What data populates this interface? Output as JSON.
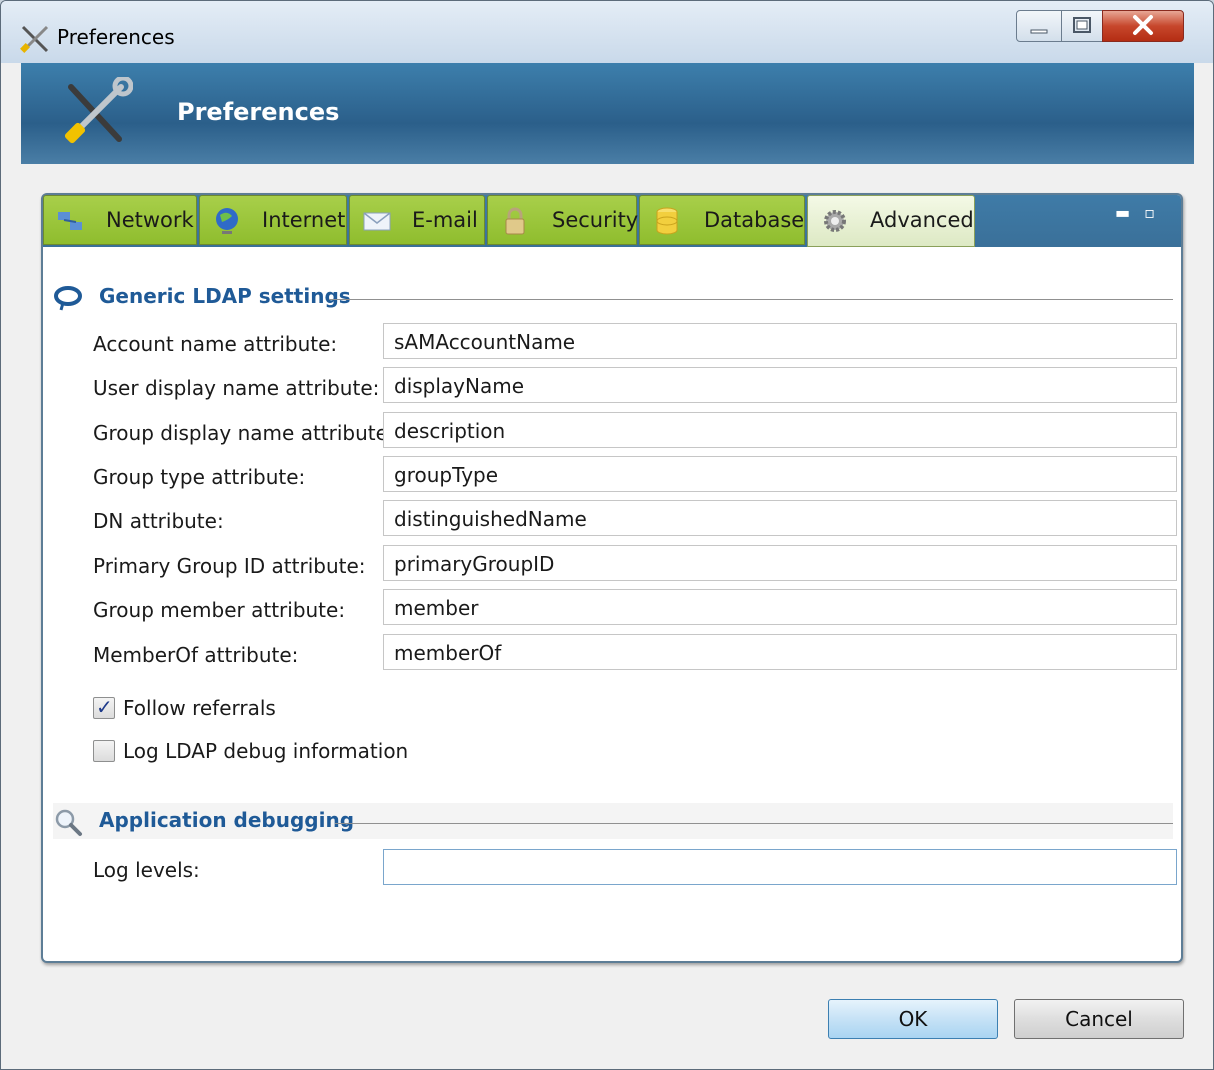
{
  "window": {
    "title": "Preferences",
    "controls": {
      "minimize": "minimize",
      "maximize": "maximize",
      "close": "close"
    }
  },
  "banner": {
    "title": "Preferences"
  },
  "tabs": [
    {
      "label": "Network",
      "icon": "network-icon",
      "active": false
    },
    {
      "label": "Internet",
      "icon": "globe-icon",
      "active": false
    },
    {
      "label": "E-mail",
      "icon": "envelope-icon",
      "active": false
    },
    {
      "label": "Security",
      "icon": "lock-icon",
      "active": false
    },
    {
      "label": "Database",
      "icon": "database-icon",
      "active": false
    },
    {
      "label": "Advanced",
      "icon": "gear-icon",
      "active": true
    }
  ],
  "sections": {
    "ldap": {
      "title": "Generic LDAP settings",
      "fields": [
        {
          "label": "Account name attribute:",
          "value": "sAMAccountName"
        },
        {
          "label": "User display name attribute:",
          "value": "displayName"
        },
        {
          "label": "Group display name attribute:",
          "value": "description"
        },
        {
          "label": "Group type attribute:",
          "value": "groupType"
        },
        {
          "label": "DN attribute:",
          "value": "distinguishedName"
        },
        {
          "label": "Primary Group ID attribute:",
          "value": "primaryGroupID"
        },
        {
          "label": "Group member attribute:",
          "value": "member"
        },
        {
          "label": "MemberOf attribute:",
          "value": "memberOf"
        }
      ],
      "checkboxes": [
        {
          "label": "Follow referrals",
          "checked": true
        },
        {
          "label": "Log LDAP debug information",
          "checked": false
        }
      ]
    },
    "debug": {
      "title": "Application debugging",
      "fields": [
        {
          "label": "Log levels:",
          "value": ""
        }
      ]
    }
  },
  "buttons": {
    "ok": "OK",
    "cancel": "Cancel"
  },
  "colors": {
    "tab_green": "#9bc53d",
    "banner_blue": "#2b5f8a",
    "section_title": "#1f5a97"
  }
}
